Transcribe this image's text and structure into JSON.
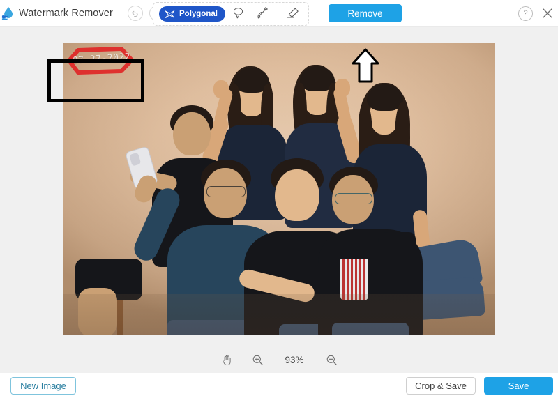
{
  "app": {
    "title": "Watermark Remover",
    "logo_icon": "water-drop-wave-logo"
  },
  "toolbar": {
    "undo_icon": "undo-arrow-icon",
    "redo_icon": "redo-arrow-icon",
    "active_tool": "Polygonal",
    "active_tool_icon": "polygonal-lasso-icon",
    "tools": [
      {
        "name": "lasso",
        "icon": "lasso-icon",
        "label": "Lasso"
      },
      {
        "name": "brush",
        "icon": "brush-icon",
        "label": "Brush"
      },
      {
        "name": "eraser",
        "icon": "eraser-icon",
        "label": "Eraser"
      }
    ],
    "remove_label": "Remove",
    "remove_color": "#1ea2e6",
    "polygonal_color": "#1f56c8",
    "help_icon": "question-mark-icon",
    "close_icon": "close-x-icon"
  },
  "canvas": {
    "watermark_text": "07-27-2022",
    "selection_color": "#e02626",
    "highlight_box_color": "#000000",
    "pointer_arrow_icon": "up-arrow-annotation",
    "background_color": "#f0f0f0"
  },
  "zoombar": {
    "pan_icon": "hand-pan-icon",
    "zoom_in_icon": "zoom-in-magnifier-icon",
    "zoom_out_icon": "zoom-out-magnifier-icon",
    "zoom_level": "93%"
  },
  "bottombar": {
    "new_image_label": "New Image",
    "crop_save_label": "Crop & Save",
    "save_label": "Save",
    "save_color": "#1ea2e6"
  }
}
